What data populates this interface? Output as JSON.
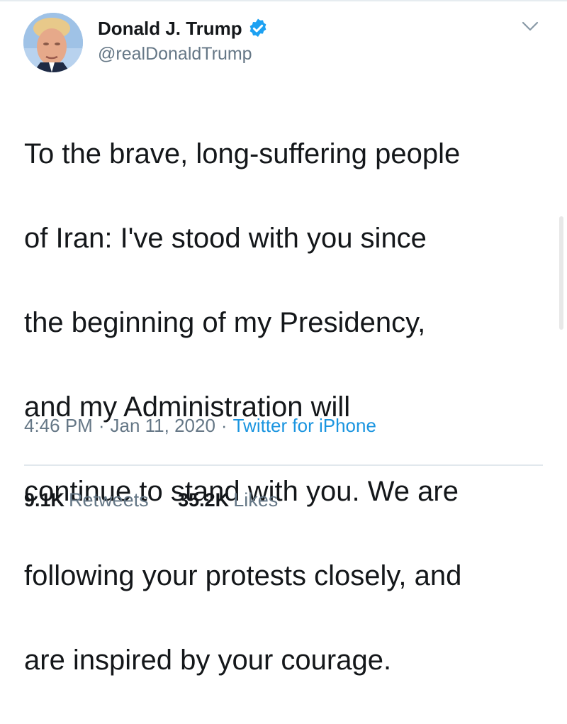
{
  "author": {
    "display_name": "Donald J. Trump",
    "handle": "@realDonaldTrump",
    "verified": true
  },
  "tweet": {
    "text_lines": [
      "To the brave, long-suffering people",
      "of Iran: I've stood with you since",
      "the beginning of my Presidency,",
      "and my Administration will",
      "continue to stand with you. We are",
      "following your protests closely, and",
      "are inspired by your courage."
    ]
  },
  "meta": {
    "time": "4:46 PM",
    "separator": "·",
    "date": "Jan 11, 2020",
    "source": "Twitter for iPhone"
  },
  "stats": {
    "retweets_count": "9.1K",
    "retweets_label": "Retweets",
    "likes_count": "35.2K",
    "likes_label": "Likes"
  },
  "icons": {
    "verified": "verified-badge-icon",
    "menu": "chevron-down-icon"
  },
  "colors": {
    "text": "#14171a",
    "secondary": "#657786",
    "link": "#1b95e0",
    "verified": "#1da1f2",
    "divider": "#e1e8ed"
  }
}
